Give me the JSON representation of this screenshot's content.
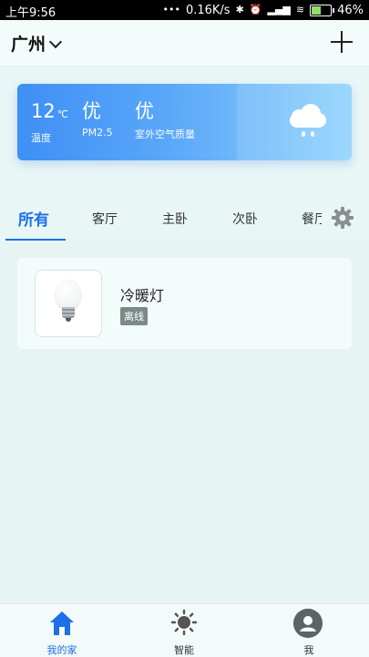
{
  "status_bar": {
    "time": "上午9:56",
    "net_speed": "0.16K/s",
    "battery": "46%"
  },
  "header": {
    "city": "广州"
  },
  "weather": {
    "temperature": "12",
    "temperature_unit": "℃",
    "temperature_label": "温度",
    "pm25_value": "优",
    "pm25_label": "PM2.5",
    "air_quality_value": "优",
    "air_quality_label": "室外空气质量",
    "icon": "rain-cloud-icon"
  },
  "tabs": [
    {
      "label": "所有",
      "active": true
    },
    {
      "label": "客厅",
      "active": false
    },
    {
      "label": "主卧",
      "active": false
    },
    {
      "label": "次卧",
      "active": false
    },
    {
      "label": "餐厅",
      "active": false
    }
  ],
  "devices": [
    {
      "name": "冷暖灯",
      "status": "离线",
      "icon": "light-bulb-icon"
    }
  ],
  "bottom_nav": [
    {
      "label": "我的家",
      "icon": "home-icon",
      "active": true
    },
    {
      "label": "智能",
      "icon": "sun-icon",
      "active": false
    },
    {
      "label": "我",
      "icon": "user-avatar-icon",
      "active": false
    }
  ],
  "colors": {
    "accent": "#1d6fe6",
    "card_gradient_start": "#3f8ff5",
    "card_gradient_end": "#8fd2fd",
    "offline_badge": "#7b8a86"
  }
}
